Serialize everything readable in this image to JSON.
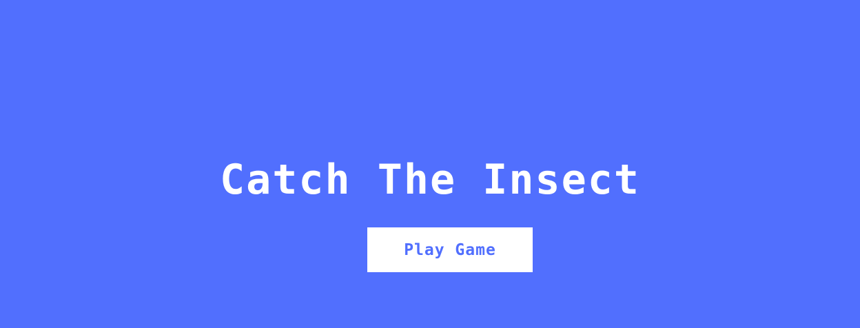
{
  "screen": {
    "title": "Catch The Insect",
    "play_button_label": "Play Game"
  },
  "colors": {
    "background": "#516ffe",
    "title_text": "#ffffff",
    "button_background": "#ffffff",
    "button_text": "#516ffe"
  }
}
